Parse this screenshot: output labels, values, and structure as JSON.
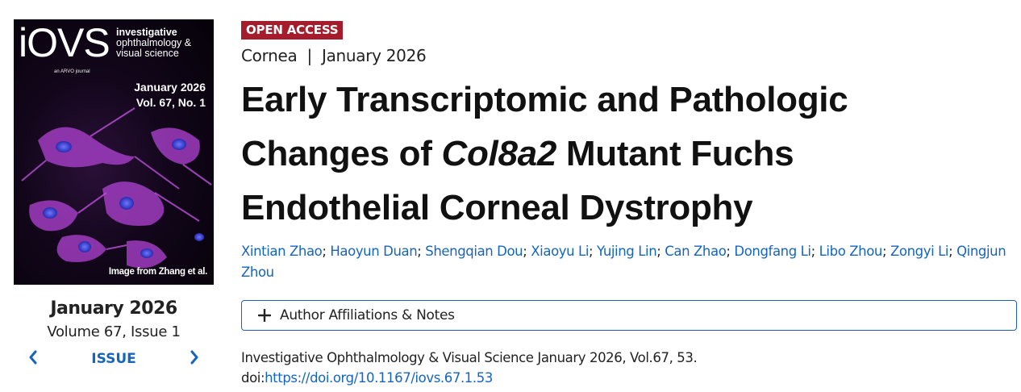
{
  "cover": {
    "logo": "iOVS",
    "journal_line1": "investigative",
    "journal_line2": "ophthalmology &",
    "journal_line3": "visual science",
    "arvo": "an ARVO journal",
    "date": "January 2026",
    "volume": "Vol. 67, No. 1",
    "credit": "Image from Zhang et al."
  },
  "issue": {
    "date": "January 2026",
    "volume_issue": "Volume 67, Issue 1",
    "nav_label": "ISSUE",
    "prev_icon": "chevron-left-icon",
    "next_icon": "chevron-right-icon"
  },
  "article": {
    "badge": "OPEN ACCESS",
    "section": "Cornea",
    "separator": "|",
    "date": "January 2026",
    "title_part1": "Early Transcriptomic and Pathologic Changes of ",
    "title_italic": "Col8a2",
    "title_part2": " Mutant Fuchs Endothelial Corneal Dystrophy",
    "authors": [
      "Xintian Zhao",
      "Haoyun Duan",
      "Shengqian Dou",
      "Xiaoyu Li",
      "Yujing Lin",
      "Can Zhao",
      "Dongfang Li",
      "Libo Zhou",
      "Zongyi Li",
      "Qingjun Zhou"
    ],
    "author_separator": "; ",
    "affiliations_label": "Author Affiliations & Notes",
    "affiliations_icon": "plus-icon",
    "citation": "Investigative Ophthalmology & Visual Science January 2026, Vol.67, 53.",
    "doi_prefix": "doi:",
    "doi_link": "https://doi.org/10.1167/iovs.67.1.53"
  },
  "colors": {
    "badge_bg": "#a51d2d",
    "link": "#1565c0",
    "affil_border": "#1f5fb5"
  }
}
